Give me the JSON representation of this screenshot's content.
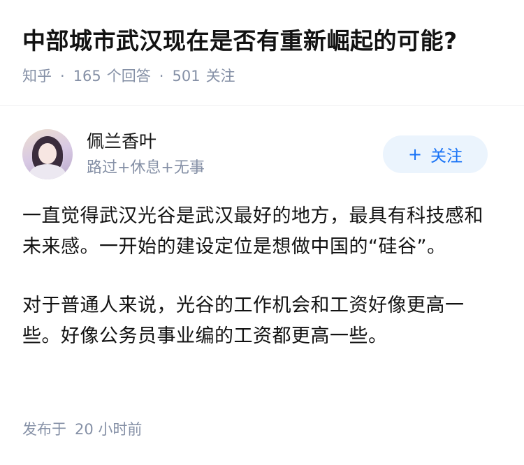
{
  "question": {
    "title": "中部城市武汉现在是否有重新崛起的可能?",
    "source": "知乎",
    "separator": "·",
    "answers_count": "165",
    "answers_label": "个回答",
    "followers_count": "501",
    "followers_label": "关注"
  },
  "author": {
    "name": "佩兰香叶",
    "bio": "路过+休息+无事",
    "follow_icon": "plus-icon",
    "follow_label": "关注"
  },
  "answer": {
    "paragraphs": [
      "一直觉得武汉光谷是武汉最好的地方，最具有科技感和未来感。一开始的建设定位是想做中国的“硅谷”。",
      "对于普通人来说，光谷的工作机会和工资好像更高一些。好像公务员事业编的工资都更高一些。"
    ],
    "published_label": "发布于",
    "published_time": "20 小时前"
  },
  "colors": {
    "accent": "#1772f6",
    "follow_bg": "#ebf4fd",
    "muted": "#8590a6"
  }
}
